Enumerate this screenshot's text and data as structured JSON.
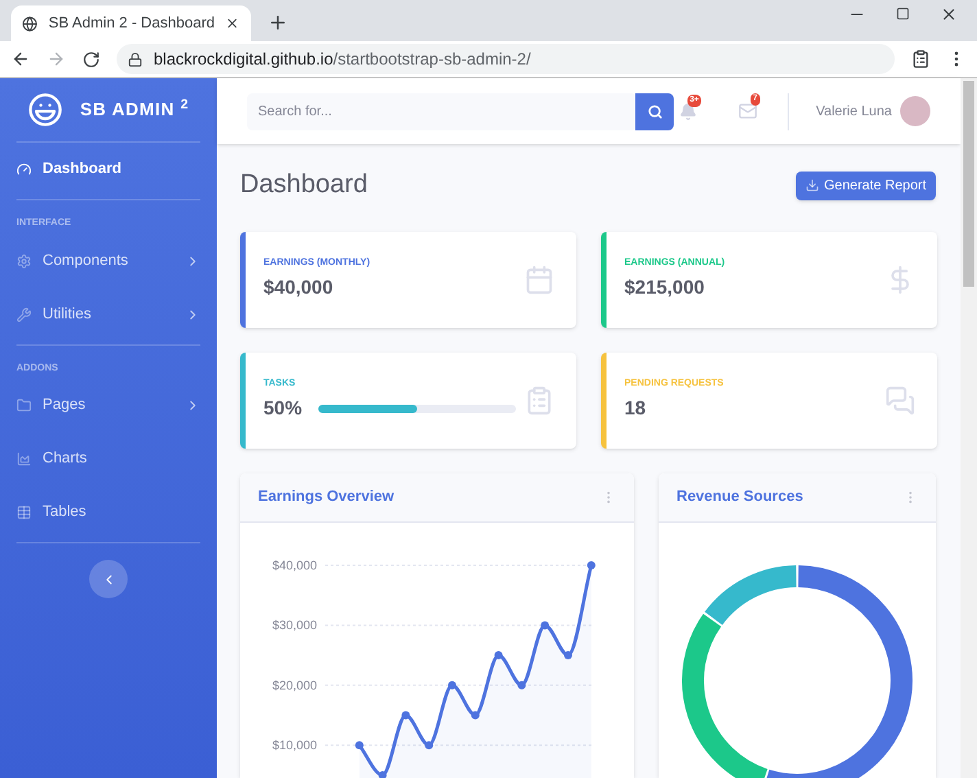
{
  "browser": {
    "tab_title": "SB Admin 2 - Dashboard",
    "url_host": "blackrockdigital.github.io",
    "url_path": "/startbootstrap-sb-admin-2/"
  },
  "sidebar": {
    "brand": "SB ADMIN $^{2}$",
    "sections": [
      {
        "items": [
          {
            "label": "Dashboard",
            "selected": true,
            "has_submenu": false
          }
        ]
      },
      {
        "heading": "INTERFACE",
        "items": [
          {
            "label": "Components",
            "selected": false,
            "has_submenu": true
          },
          {
            "label": "Utilities",
            "selected": false,
            "has_submenu": true
          }
        ]
      },
      {
        "heading": "ADDONS",
        "items": [
          {
            "label": "Pages",
            "selected": false,
            "has_submenu": true
          },
          {
            "label": "Charts",
            "selected": false,
            "has_submenu": false
          },
          {
            "label": "Tables",
            "selected": false,
            "has_submenu": false
          }
        ]
      }
    ]
  },
  "topbar": {
    "search": {
      "placeholder": "Search for..."
    },
    "alerts_badge": "3+",
    "messages_badge": "7",
    "user_name": "Valerie Luna"
  },
  "page": {
    "title": "Dashboard",
    "action": "Generate Report"
  },
  "cards": [
    {
      "kind": "stat",
      "label": "EARNINGS (MONTHLY)",
      "value": "$40,000",
      "color": "#4e73df"
    },
    {
      "kind": "stat",
      "label": "EARNINGS (ANNUAL)",
      "value": "$215,000",
      "color": "#1cc88a"
    },
    {
      "kind": "progress",
      "label": "TASKS",
      "value": "50%",
      "color": "#36b9cc",
      "level": 0.5
    },
    {
      "kind": "stat",
      "label": "PENDING REQUESTS",
      "value": "18",
      "color": "#f6c23e"
    }
  ],
  "earnings_overview": {
    "title": "Earnings Overview",
    "chart_data": {
      "type": "area",
      "yticks": [
        {
          "value": 10000,
          "label": "$10,000"
        },
        {
          "value": 20000,
          "label": "$20,000"
        },
        {
          "value": 30000,
          "label": "$30,000"
        },
        {
          "value": 40000,
          "label": "$40,000"
        }
      ],
      "ylim": [
        0,
        40000
      ],
      "grid": true,
      "series": [
        {
          "color": "#4e73df",
          "values": [
            10000,
            5000,
            15000,
            10000,
            20000,
            15000,
            25000,
            20000,
            30000,
            25000,
            40000
          ]
        }
      ]
    }
  },
  "revenue_sources": {
    "title": "Revenue Sources"
  }
}
